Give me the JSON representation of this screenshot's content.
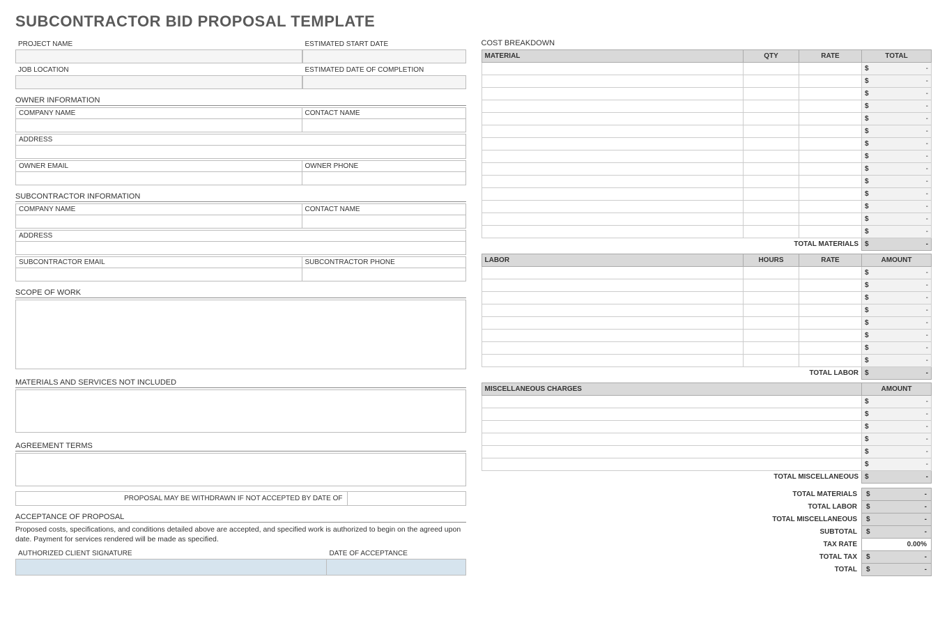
{
  "title": "SUBCONTRACTOR BID PROPOSAL TEMPLATE",
  "left": {
    "project_name_label": "PROJECT NAME",
    "est_start_label": "ESTIMATED START DATE",
    "job_location_label": "JOB LOCATION",
    "est_completion_label": "ESTIMATED DATE OF COMPLETION",
    "owner_info_title": "OWNER INFORMATION",
    "owner_company_label": "COMPANY NAME",
    "owner_contact_label": "CONTACT NAME",
    "owner_address_label": "ADDRESS",
    "owner_email_label": "OWNER EMAIL",
    "owner_phone_label": "OWNER PHONE",
    "sub_info_title": "SUBCONTRACTOR INFORMATION",
    "sub_company_label": "COMPANY NAME",
    "sub_contact_label": "CONTACT NAME",
    "sub_address_label": "ADDRESS",
    "sub_email_label": "SUBCONTRACTOR EMAIL",
    "sub_phone_label": "SUBCONTRACTOR PHONE",
    "scope_title": "SCOPE OF WORK",
    "not_included_title": "MATERIALS AND SERVICES NOT INCLUDED",
    "agreement_title": "AGREEMENT TERMS",
    "withdraw_label": "PROPOSAL MAY BE WITHDRAWN IF NOT ACCEPTED BY DATE OF",
    "acceptance_title": "ACCEPTANCE OF PROPOSAL",
    "acceptance_text": "Proposed costs, specifications, and conditions detailed above are accepted, and specified work is authorized to begin on the agreed upon date.  Payment for services rendered will be made as specified.",
    "sig_label": "AUTHORIZED CLIENT SIGNATURE",
    "date_accept_label": "DATE OF ACCEPTANCE"
  },
  "cost": {
    "breakdown_title": "COST BREAKDOWN",
    "material_header": "MATERIAL",
    "qty_header": "QTY",
    "rate_header": "RATE",
    "total_header": "TOTAL",
    "labor_header": "LABOR",
    "hours_header": "HOURS",
    "amount_header": "AMOUNT",
    "misc_header": "MISCELLANEOUS CHARGES",
    "currency": "$",
    "dash": "-",
    "total_materials_label": "TOTAL MATERIALS",
    "total_labor_label": "TOTAL LABOR",
    "total_misc_label": "TOTAL MISCELLANEOUS",
    "material_rows": 14,
    "labor_rows": 8,
    "misc_rows": 6,
    "summary": {
      "total_materials": "TOTAL MATERIALS",
      "total_labor": "TOTAL LABOR",
      "total_misc": "TOTAL MISCELLANEOUS",
      "subtotal": "SUBTOTAL",
      "tax_rate_label": "TAX RATE",
      "tax_rate_value": "0.00%",
      "total_tax": "TOTAL TAX",
      "total": "TOTAL"
    }
  }
}
